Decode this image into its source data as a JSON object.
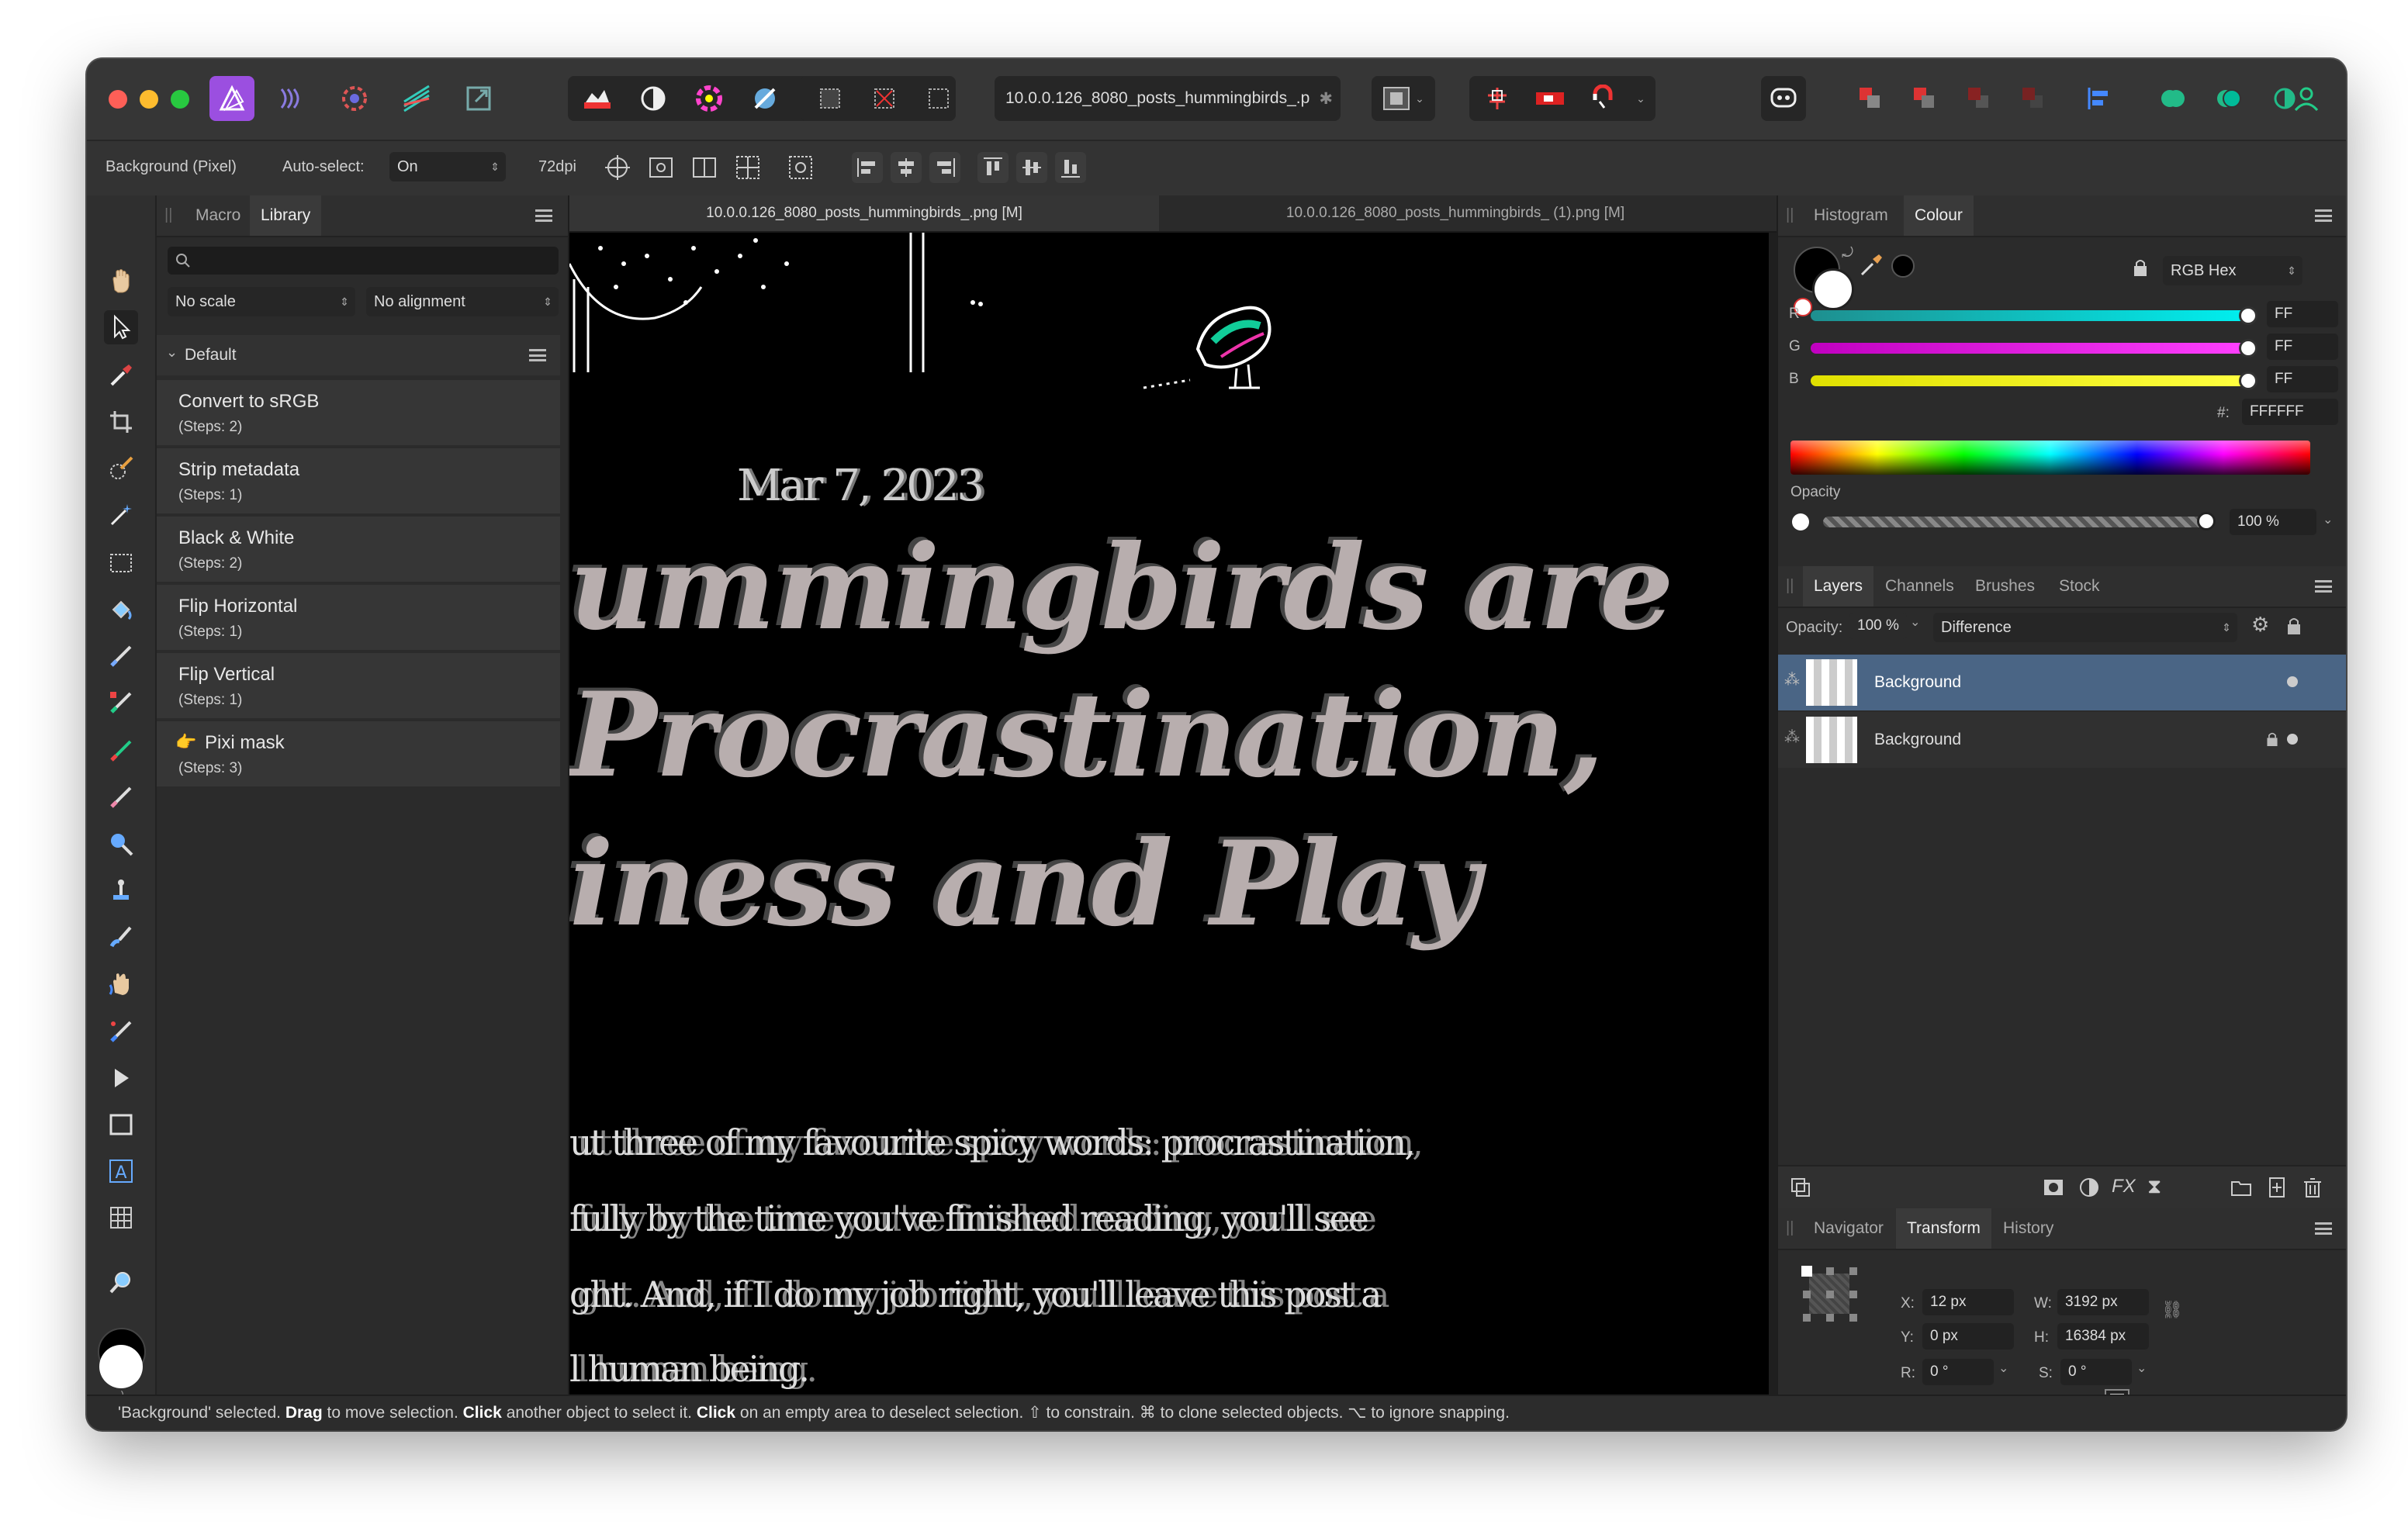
{
  "window": {
    "title_field": "10.0.0.126_8080_posts_hummingbirds_.p",
    "context_toolbar": {
      "layer_label": "Background (Pixel)",
      "auto_select_label": "Auto-select:",
      "auto_select_value": "On",
      "dpi": "72dpi"
    }
  },
  "left_panel": {
    "tabs": [
      "Macro",
      "Library"
    ],
    "active_tab": "Library",
    "search_placeholder": "",
    "scale_select": "No scale",
    "alignment_select": "No alignment",
    "group": "Default",
    "macros": [
      {
        "title": "Convert to sRGB",
        "steps": "(Steps: 2)"
      },
      {
        "title": "Strip metadata",
        "steps": "(Steps: 1)"
      },
      {
        "title": "Black & White",
        "steps": "(Steps: 2)"
      },
      {
        "title": "Flip Horizontal",
        "steps": "(Steps: 1)"
      },
      {
        "title": "Flip Vertical",
        "steps": "(Steps: 1)"
      },
      {
        "title": "Pixi mask",
        "steps": "(Steps: 3)"
      }
    ]
  },
  "documents": {
    "tabs": [
      {
        "label": "10.0.0.126_8080_posts_hummingbirds_.png [M]",
        "active": true
      },
      {
        "label": "10.0.0.126_8080_posts_hummingbirds_ (1).png [M]",
        "active": false
      }
    ]
  },
  "canvas_text": {
    "date": "Mar 7, 2023",
    "headline_1": "ummingbirds are",
    "headline_2": "Procrastination,",
    "headline_3": "iness and Play",
    "body_1": "ut three of my favourite spicy words: procrastination,",
    "body_2": "fully by the time you've finished reading, you'll see",
    "body_3": "ght. And, if I do my job right, you'll leave this post a",
    "body_4": "l human being."
  },
  "colour_panel": {
    "tabs": [
      "Histogram",
      "Colour"
    ],
    "active_tab": "Colour",
    "mode": "RGB Hex",
    "channels": [
      {
        "label": "R",
        "value": "FF"
      },
      {
        "label": "G",
        "value": "FF"
      },
      {
        "label": "B",
        "value": "FF"
      }
    ],
    "hex_label": "#:",
    "hex_value": "FFFFFF",
    "opacity_label": "Opacity",
    "opacity_value": "100 %"
  },
  "layers_panel": {
    "tabs": [
      "Layers",
      "Channels",
      "Brushes",
      "Stock"
    ],
    "active_tab": "Layers",
    "opacity_label": "Opacity:",
    "opacity_value": "100 %",
    "blend_mode": "Difference",
    "layers": [
      {
        "name": "Background",
        "selected": true,
        "locked": false
      },
      {
        "name": "Background",
        "selected": false,
        "locked": true
      }
    ]
  },
  "transform_panel": {
    "tabs": [
      "Navigator",
      "Transform",
      "History"
    ],
    "active_tab": "Transform",
    "x_label": "X:",
    "x": "12 px",
    "y_label": "Y:",
    "y": "0 px",
    "w_label": "W:",
    "w": "3192 px",
    "h_label": "H:",
    "h": "16384 px",
    "r_label": "R:",
    "r": "0 °",
    "s_label": "S:",
    "s": "0 °"
  },
  "status": {
    "p1": "'Background' selected.",
    "b1": "Drag",
    "p2": "to move selection.",
    "b2": "Click",
    "p3": "another object to select it.",
    "b3": "Click",
    "p4": "on an empty area to deselect selection. ⇧ to constrain. ⌘ to clone selected objects. ⌥ to ignore snapping."
  },
  "colors": {
    "accent_selected_layer": "#4a6585",
    "affinity_purple": "#a34ee0",
    "slider_r": "#00e5e5",
    "slider_g": "#e000e0",
    "slider_b": "#e8e800"
  }
}
